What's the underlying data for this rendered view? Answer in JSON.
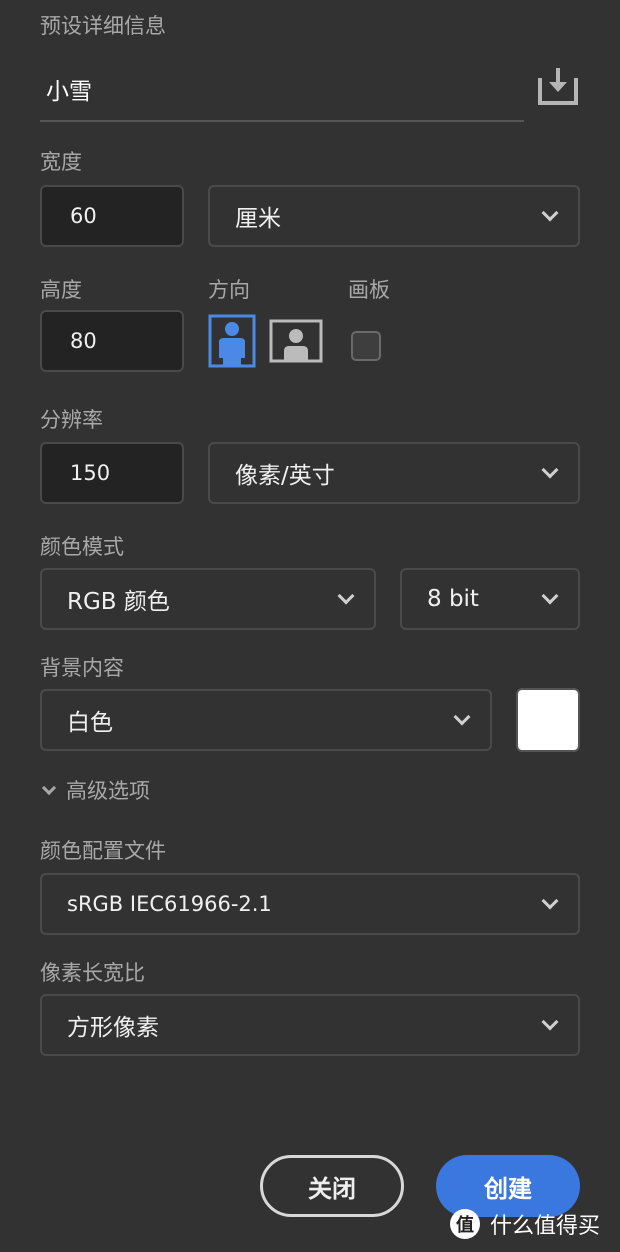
{
  "section_title": "预设详细信息",
  "preset_name": "小雪",
  "width": {
    "label": "宽度",
    "value": "60",
    "unit": "厘米"
  },
  "height": {
    "label": "高度",
    "value": "80"
  },
  "orientation": {
    "label": "方向",
    "selected": "portrait"
  },
  "artboard": {
    "label": "画板",
    "checked": false
  },
  "resolution": {
    "label": "分辨率",
    "value": "150",
    "unit": "像素/英寸"
  },
  "color_mode": {
    "label": "颜色模式",
    "mode": "RGB 颜色",
    "depth": "8 bit"
  },
  "background": {
    "label": "背景内容",
    "value": "白色",
    "swatch": "#ffffff"
  },
  "advanced": {
    "label": "高级选项"
  },
  "color_profile": {
    "label": "颜色配置文件",
    "value": "sRGB IEC61966-2.1"
  },
  "pixel_aspect": {
    "label": "像素长宽比",
    "value": "方形像素"
  },
  "buttons": {
    "close": "关闭",
    "create": "创建"
  },
  "watermark": {
    "logo": "值",
    "text": "什么值得买"
  },
  "colors": {
    "accent": "#3a78e0",
    "bg": "#323232"
  }
}
